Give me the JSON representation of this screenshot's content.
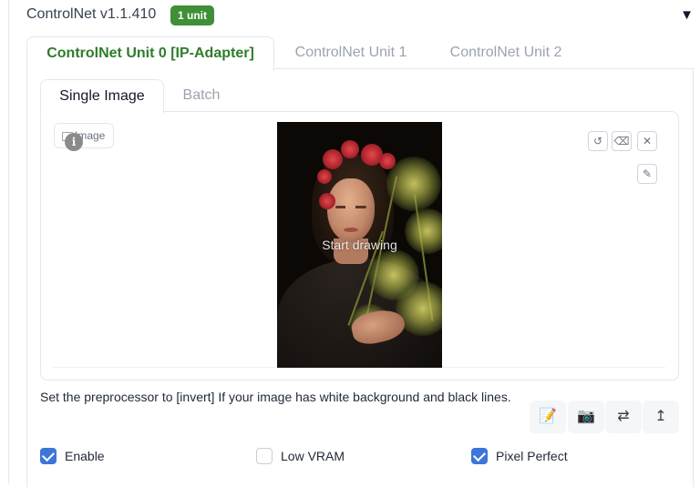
{
  "accordion": {
    "title": "ControlNet v1.1.410",
    "badge": "1 unit",
    "toggle_icon": "▼"
  },
  "unit_tabs": [
    {
      "label": "ControlNet Unit 0 [IP-Adapter]",
      "active": true
    },
    {
      "label": "ControlNet Unit 1",
      "active": false
    },
    {
      "label": "ControlNet Unit 2",
      "active": false
    }
  ],
  "image_tabs": [
    {
      "label": "Single Image",
      "active": true
    },
    {
      "label": "Batch",
      "active": false
    }
  ],
  "image_input": {
    "label": "Image",
    "overlay_text": "Start drawing",
    "info_icon": "i",
    "tools": {
      "undo": "↺",
      "clear": "⌫",
      "remove": "✕",
      "brush": "✎"
    }
  },
  "preprocessor_note": "Set the preprocessor to [invert] If your image has white background and black lines.",
  "action_buttons": {
    "edit": "📝",
    "camera": "📷",
    "swap": "⇄",
    "upload": "↥"
  },
  "checkboxes": [
    {
      "label": "Enable",
      "checked": true
    },
    {
      "label": "Low VRAM",
      "checked": false
    },
    {
      "label": "Pixel Perfect",
      "checked": true
    }
  ],
  "colors": {
    "accent_green": "#2f7d2a",
    "badge_green": "#3f8f36",
    "checkbox_blue": "#3b76d8"
  }
}
